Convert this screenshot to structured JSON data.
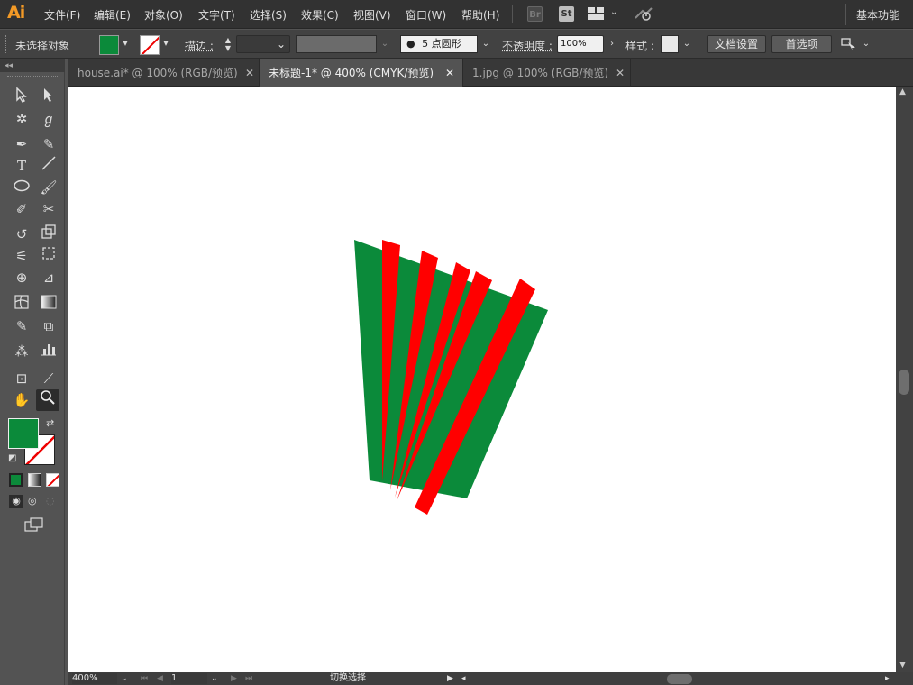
{
  "app": {
    "logo": "Ai"
  },
  "menus": [
    "文件(F)",
    "编辑(E)",
    "对象(O)",
    "文字(T)",
    "选择(S)",
    "效果(C)",
    "视图(V)",
    "窗口(W)",
    "帮助(H)"
  ],
  "menubar_icons": {
    "bridge": "Br",
    "stock": "St"
  },
  "workspace_label": "基本功能",
  "control": {
    "selection_status": "未选择对象",
    "fill_color": "#0b8a3a",
    "stroke_label": "描边 :",
    "brush_label": "5 点圆形",
    "opacity_label": "不透明度 :",
    "opacity_value": "100%",
    "style_label": "样式 :",
    "doc_setup_button": "文档设置",
    "preferences_button": "首选项"
  },
  "tabs": [
    {
      "label": "house.ai* @ 100% (RGB/预览)",
      "active": false
    },
    {
      "label": "未标题-1* @ 400% (CMYK/预览)",
      "active": true
    },
    {
      "label": "1.jpg @ 100% (RGB/预览)",
      "active": false
    }
  ],
  "tools_panel": {
    "fill_color": "#0b8a3a",
    "stroke": "none"
  },
  "artwork": {
    "colors": {
      "green": "#0b8a3a",
      "red": "#ff0000"
    }
  },
  "status": {
    "zoom": "400%",
    "artboard": "1",
    "mode": "切换选择"
  }
}
